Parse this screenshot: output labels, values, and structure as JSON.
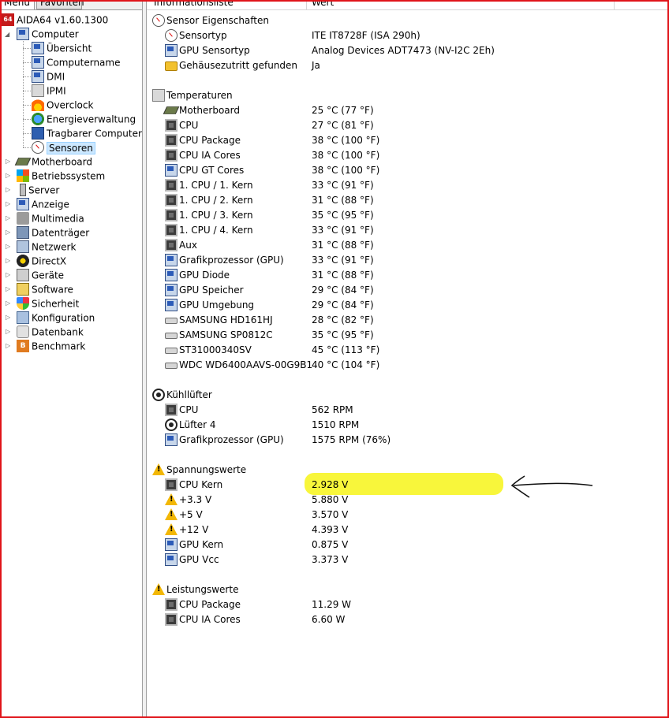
{
  "tabs": {
    "menu": "Menü",
    "favorites": "Favoriten"
  },
  "tree": {
    "root": "AIDA64 v1.60.1300",
    "computer": "Computer",
    "computer_children": [
      "Übersicht",
      "Computername",
      "DMI",
      "IPMI",
      "Overclock",
      "Energieverwaltung",
      "Tragbarer Computer",
      "Sensoren"
    ],
    "categories": [
      "Motherboard",
      "Betriebssystem",
      "Server",
      "Anzeige",
      "Multimedia",
      "Datenträger",
      "Netzwerk",
      "DirectX",
      "Geräte",
      "Software",
      "Sicherheit",
      "Konfiguration",
      "Datenbank",
      "Benchmark"
    ]
  },
  "columns": {
    "info": "Informationsliste",
    "value": "Wert"
  },
  "groups": {
    "sensor": "Sensor Eigenschaften",
    "temps": "Temperaturen",
    "fans": "Kühllüfter",
    "volts": "Spannungswerte",
    "power": "Leistungswerte"
  },
  "sensor_props": [
    {
      "name": "Sensortyp",
      "value": "ITE IT8728F  (ISA 290h)",
      "icon": "gauge-icon"
    },
    {
      "name": "GPU Sensortyp",
      "value": "Analog Devices ADT7473  (NV-I2C 2Eh)",
      "icon": "gpu-icon"
    },
    {
      "name": "Gehäusezutritt gefunden",
      "value": "Ja",
      "icon": "lock-icon"
    }
  ],
  "temperatures": [
    {
      "name": "Motherboard",
      "value": "25 °C  (77 °F)",
      "icon": "motherboard-icon"
    },
    {
      "name": "CPU",
      "value": "27 °C  (81 °F)",
      "icon": "cpu-icon"
    },
    {
      "name": "CPU Package",
      "value": "38 °C  (100 °F)",
      "icon": "cpu-icon"
    },
    {
      "name": "CPU IA Cores",
      "value": "38 °C  (100 °F)",
      "icon": "cpu-icon"
    },
    {
      "name": "CPU GT Cores",
      "value": "38 °C  (100 °F)",
      "icon": "gpu-icon"
    },
    {
      "name": "1. CPU / 1. Kern",
      "value": "33 °C  (91 °F)",
      "icon": "cpu-icon"
    },
    {
      "name": "1. CPU / 2. Kern",
      "value": "31 °C  (88 °F)",
      "icon": "cpu-icon"
    },
    {
      "name": "1. CPU / 3. Kern",
      "value": "35 °C  (95 °F)",
      "icon": "cpu-icon"
    },
    {
      "name": "1. CPU / 4. Kern",
      "value": "33 °C  (91 °F)",
      "icon": "cpu-icon"
    },
    {
      "name": "Aux",
      "value": "31 °C  (88 °F)",
      "icon": "cpu-icon"
    },
    {
      "name": "Grafikprozessor (GPU)",
      "value": "33 °C  (91 °F)",
      "icon": "gpu-icon"
    },
    {
      "name": "GPU Diode",
      "value": "31 °C  (88 °F)",
      "icon": "gpu-icon"
    },
    {
      "name": "GPU Speicher",
      "value": "29 °C  (84 °F)",
      "icon": "gpu-icon"
    },
    {
      "name": "GPU Umgebung",
      "value": "29 °C  (84 °F)",
      "icon": "gpu-icon"
    },
    {
      "name": "SAMSUNG HD161HJ",
      "value": "28 °C  (82 °F)",
      "icon": "disk-icon"
    },
    {
      "name": "SAMSUNG SP0812C",
      "value": "35 °C  (95 °F)",
      "icon": "disk-icon"
    },
    {
      "name": "ST31000340SV",
      "value": "45 °C  (113 °F)",
      "icon": "disk-icon"
    },
    {
      "name": "WDC WD6400AAVS-00G9B1",
      "value": "40 °C  (104 °F)",
      "icon": "disk-icon"
    }
  ],
  "fans": [
    {
      "name": "CPU",
      "value": "562 RPM",
      "icon": "cpu-icon"
    },
    {
      "name": "Lüfter 4",
      "value": "1510 RPM",
      "icon": "fan-icon"
    },
    {
      "name": "Grafikprozessor (GPU)",
      "value": "1575 RPM  (76%)",
      "icon": "gpu-icon"
    }
  ],
  "voltages": [
    {
      "name": "CPU Kern",
      "value": "2.928 V",
      "icon": "cpu-icon",
      "highlighted": true
    },
    {
      "name": "+3.3 V",
      "value": "5.880 V",
      "icon": "warning-icon"
    },
    {
      "name": "+5 V",
      "value": "3.570 V",
      "icon": "warning-icon"
    },
    {
      "name": "+12 V",
      "value": "4.393 V",
      "icon": "warning-icon"
    },
    {
      "name": "GPU Kern",
      "value": "0.875 V",
      "icon": "gpu-icon"
    },
    {
      "name": "GPU Vcc",
      "value": "3.373 V",
      "icon": "gpu-icon"
    }
  ],
  "power_values": [
    {
      "name": "CPU Package",
      "value": "11.29 W",
      "icon": "cpu-icon"
    },
    {
      "name": "CPU IA Cores",
      "value": "6.60 W",
      "icon": "cpu-icon"
    }
  ],
  "colors": {
    "frame": "#e0141a",
    "highlight": "#f7f52a",
    "selection": "#cce8ff"
  }
}
